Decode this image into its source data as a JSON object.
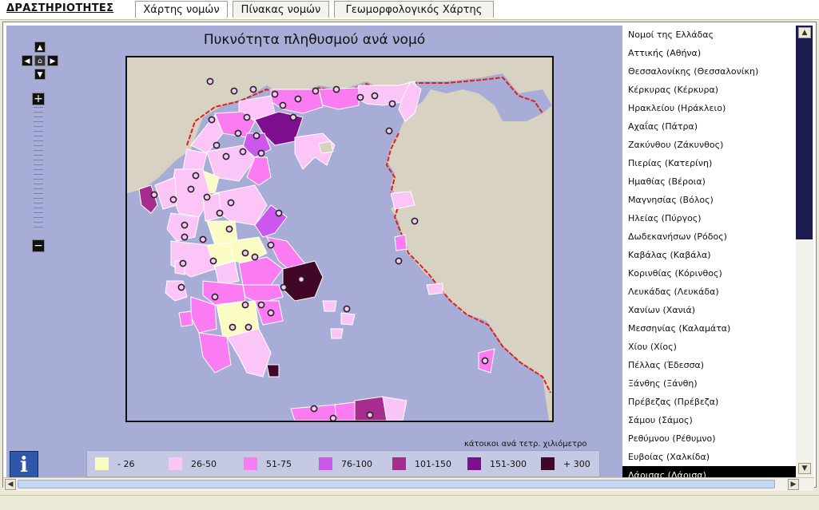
{
  "menu": {
    "label": "ΔΡΑΣΤΗΡΙΟΤΗΤΕΣ"
  },
  "tabs": [
    {
      "label": "Χάρτης νομών",
      "active": true
    },
    {
      "label": "Πίνακας νομών",
      "active": false
    },
    {
      "label": "Γεωμορφολογικός Χάρτης",
      "active": false
    }
  ],
  "map": {
    "title": "Πυκνότητα πληθυσμού ανά νομό",
    "nav": {
      "up": "▲",
      "down": "▼",
      "left": "◀",
      "right": "▶",
      "home": "⌂",
      "zoom_in": "+",
      "zoom_out": "−"
    },
    "info_label": "i"
  },
  "legend": {
    "caption": "κάτοικοι ανά τετρ. χιλιόμετρο",
    "items": [
      {
        "label": "- 26",
        "color": "#fbfbc4"
      },
      {
        "label": "26-50",
        "color": "#fbc5f7"
      },
      {
        "label": "51-75",
        "color": "#fb7cf2"
      },
      {
        "label": "76-100",
        "color": "#cc57ec"
      },
      {
        "label": "101-150",
        "color": "#a62d8e"
      },
      {
        "label": "151-300",
        "color": "#7d0e8d"
      },
      {
        "label": "+ 300",
        "color": "#400727"
      }
    ]
  },
  "prefecture_list": {
    "items": [
      "Νομοί της Ελλάδας",
      "Αττικής (Αθήνα)",
      "Θεσσαλονίκης (Θεσσαλονίκη)",
      "Κέρκυρας (Κέρκυρα)",
      "Ηρακλείου (Ηράκλειο)",
      "Αχαΐας (Πάτρα)",
      "Ζακύνθου (Ζάκυνθος)",
      "Πιερίας (Κατερίνη)",
      "Ημαθίας (Βέροια)",
      "Μαγνησίας (Βόλος)",
      "Ηλείας (Πύργος)",
      "Δωδεκανήσων (Ρόδος)",
      "Καβάλας (Καβάλα)",
      "Κορινθίας (Κόρινθος)",
      "Λευκάδας (Λευκάδα)",
      "Χανίων (Χανιά)",
      "Μεσσηνίας (Καλαμάτα)",
      "Χίου (Χίος)",
      "Πέλλας (Έδεσσα)",
      "Ξάνθης (Ξάνθη)",
      "Πρέβεζας (Πρέβεζα)",
      "Σάμου (Σάμος)",
      "Ρεθύμνου (Ρέθυμνο)",
      "Ευβοίας (Χαλκίδα)",
      "Λάρισας (Λάρισα)"
    ],
    "selected_index": 24
  },
  "colors": {
    "sea": "#a7add6",
    "land_other": "#d8d2c2",
    "border_line": "#e0201c",
    "city_marker": "#222222"
  }
}
